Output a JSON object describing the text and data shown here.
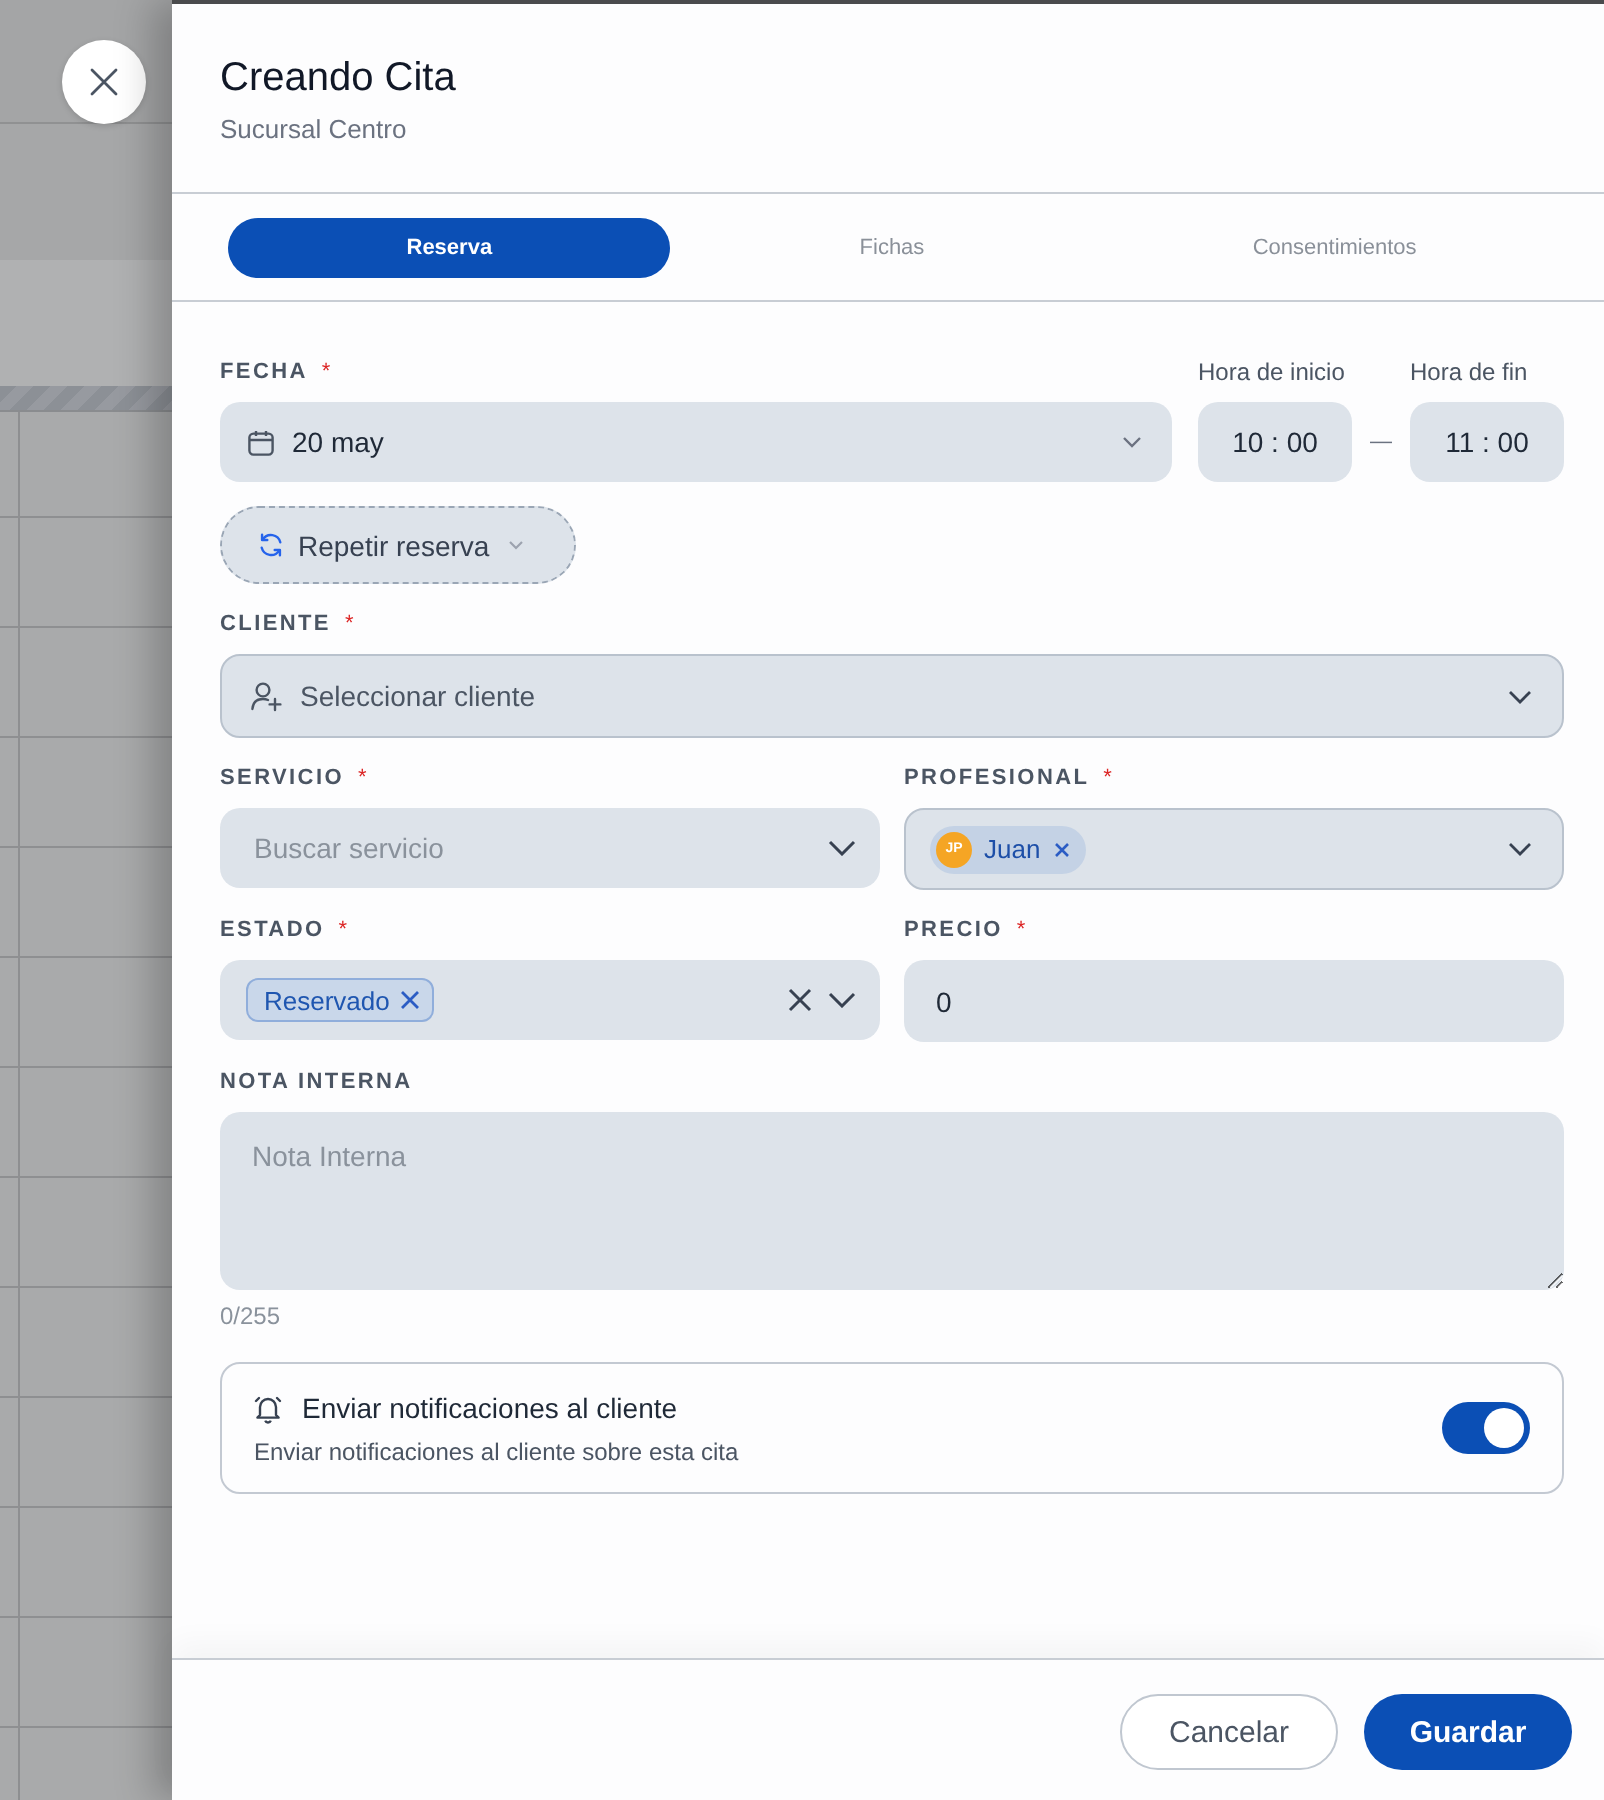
{
  "header": {
    "title": "Creando Cita",
    "subtitle": "Sucursal Centro"
  },
  "tabs": [
    {
      "label": "Reserva",
      "selected": true
    },
    {
      "label": "Fichas",
      "selected": false
    },
    {
      "label": "Consentimientos",
      "selected": false
    }
  ],
  "date": {
    "label": "FECHA",
    "required_mark": "*",
    "value": "20 may"
  },
  "time": {
    "start": {
      "label": "Hora de inicio",
      "value": "10 : 00"
    },
    "range_separator": "—",
    "end": {
      "label": "Hora de fin",
      "value": "11 : 00"
    }
  },
  "repeat_button": {
    "label": "Repetir reserva"
  },
  "client": {
    "label": "CLIENTE",
    "required_mark": "*",
    "placeholder": "Seleccionar cliente"
  },
  "service": {
    "label": "SERVICIO",
    "required_mark": "*",
    "placeholder": "Buscar servicio"
  },
  "professional": {
    "label": "PROFESIONAL",
    "required_mark": "*",
    "chips": [
      {
        "initials": "JP",
        "name": "Juan"
      }
    ]
  },
  "status": {
    "label": "ESTADO",
    "required_mark": "*",
    "chips": [
      {
        "label": "Reservado"
      }
    ]
  },
  "price": {
    "label": "PRECIO",
    "required_mark": "*",
    "value": "0"
  },
  "note": {
    "label": "NOTA INTERNA",
    "placeholder": "Nota Interna",
    "counter": "0/255"
  },
  "notifications": {
    "title": "Enviar notificaciones al cliente",
    "description": "Enviar notificaciones al cliente sobre esta cita",
    "on": true
  },
  "buttons": [
    {
      "label": "Cancelar",
      "kind": "secondary"
    },
    {
      "label": "Guardar",
      "kind": "primary"
    }
  ]
}
